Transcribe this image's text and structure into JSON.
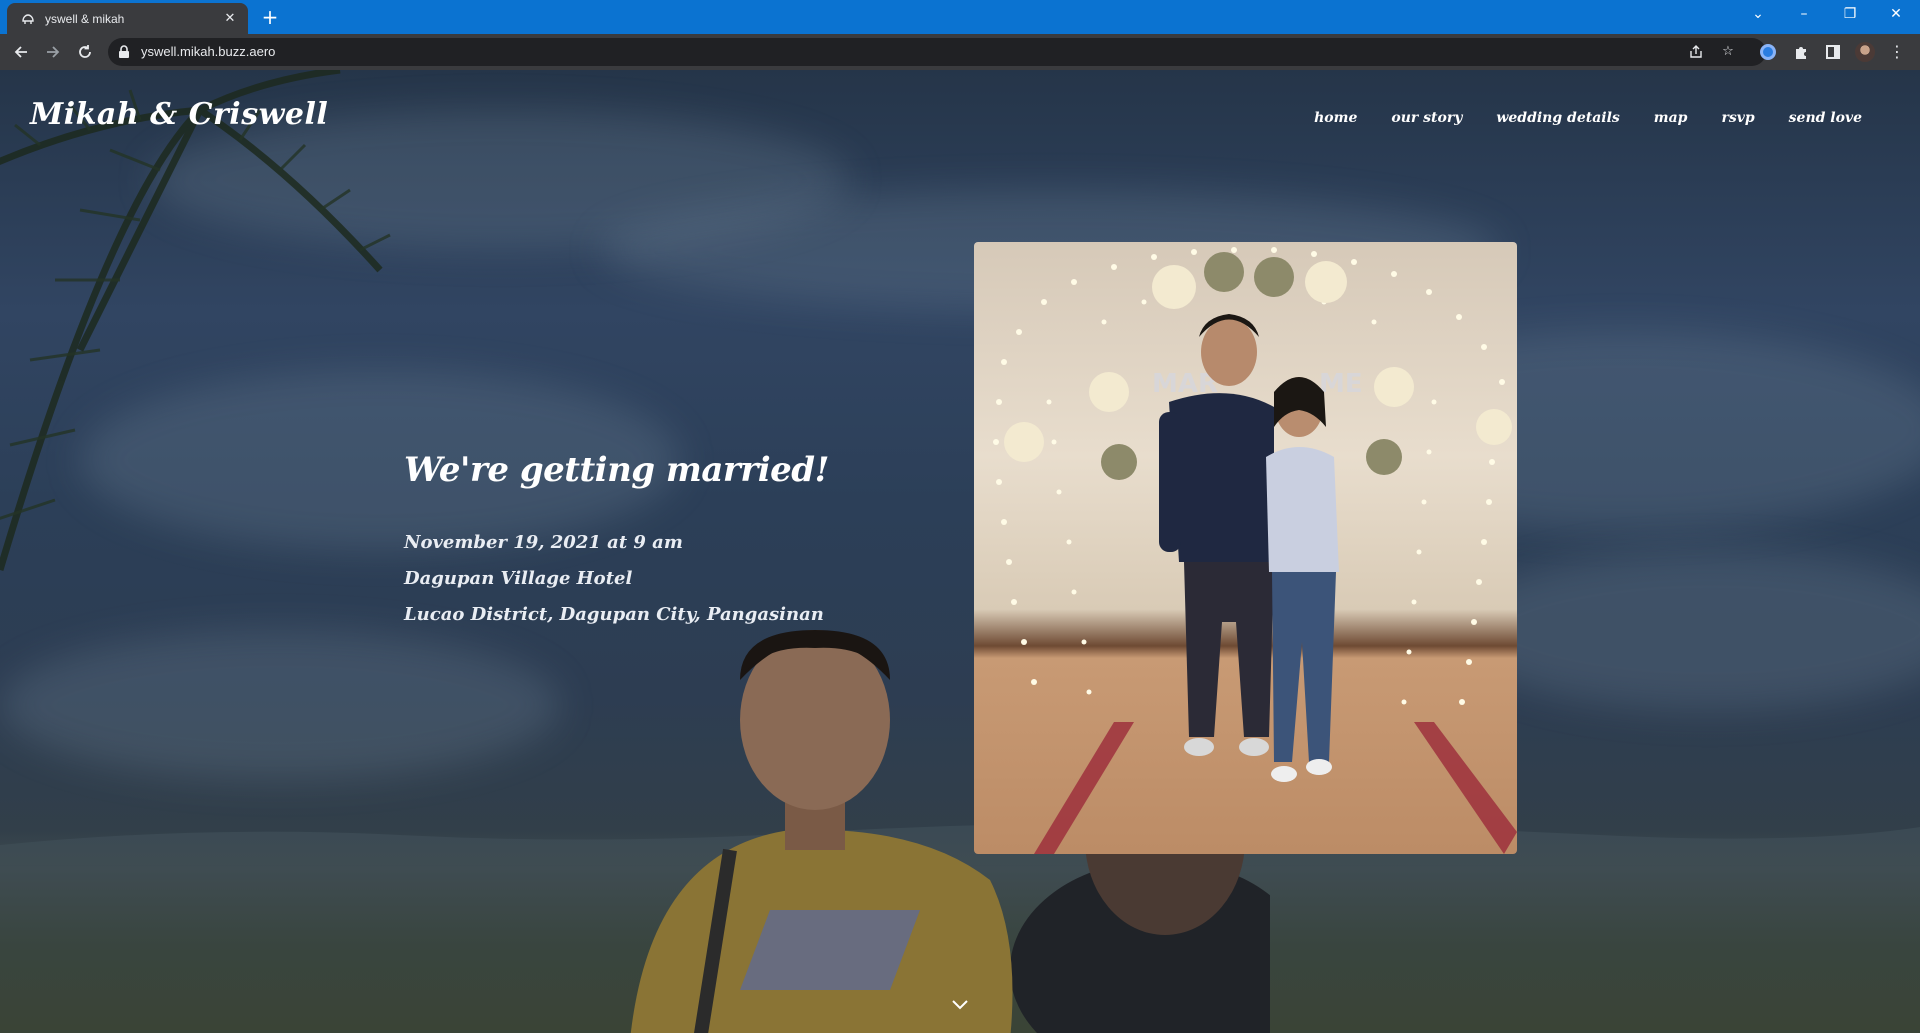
{
  "browser": {
    "tab_title": "yswell & mikah",
    "url": "yswell.mikah.buzz.aero",
    "icons": {
      "back": "arrow-left-icon",
      "forward": "arrow-right-icon",
      "reload": "reload-icon",
      "lock": "lock-icon",
      "share": "share-icon",
      "bookmark": "star-icon",
      "extension": "extension-icon",
      "puzzle": "puzzle-icon",
      "side_panel": "side-panel-icon",
      "profile": "avatar-icon",
      "menu": "kebab-menu-icon"
    }
  },
  "site": {
    "logo": "Mikah & Criswell",
    "nav": [
      "home",
      "our story",
      "wedding details",
      "map",
      "rsvp",
      "send love"
    ]
  },
  "hero": {
    "heading": "We're getting married!",
    "lines": [
      "November 19, 2021 at 9 am",
      "Dagupan Village Hotel",
      "Lucao District, Dagupan City, Pangasinan"
    ]
  },
  "colors": {
    "tabbar": "#0b73d1",
    "chrome_dark": "#3a3b3e",
    "text_white": "#ffffff"
  }
}
